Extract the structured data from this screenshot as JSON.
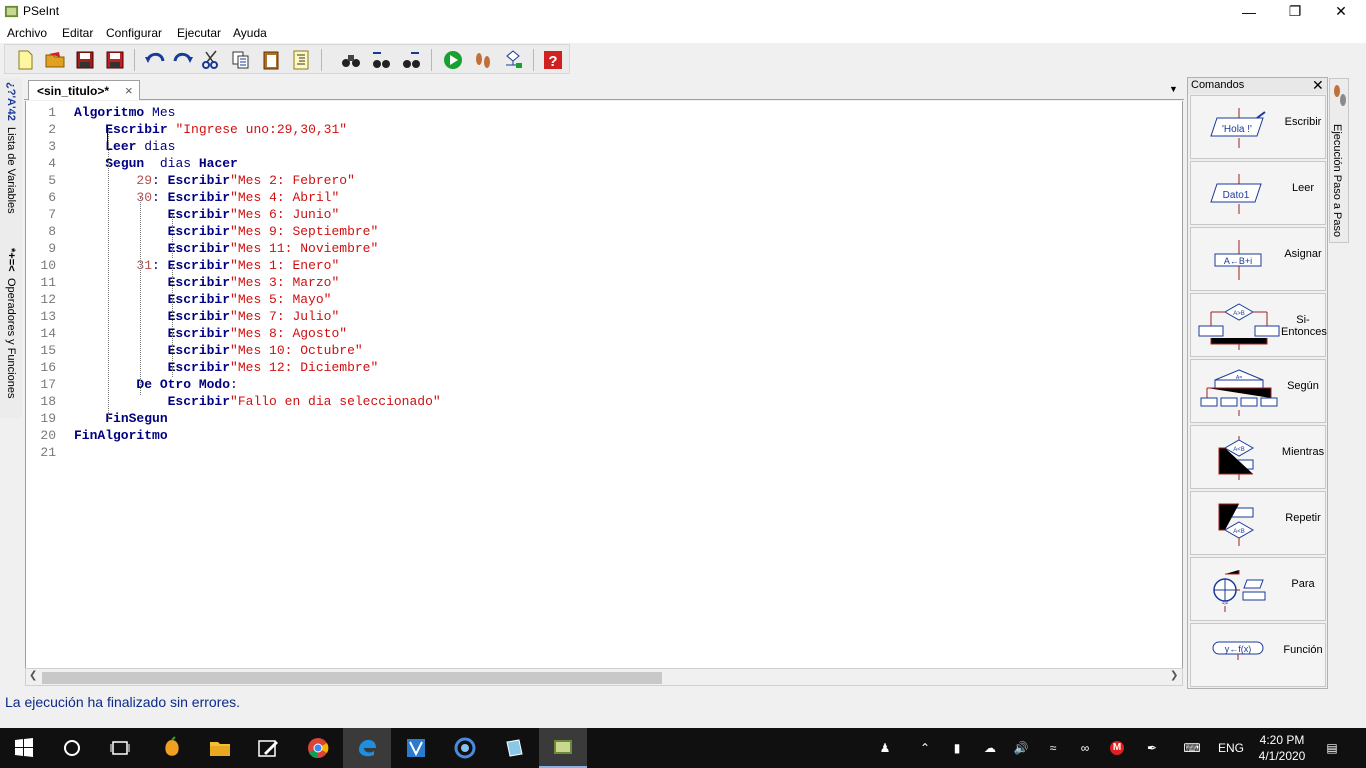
{
  "window": {
    "title": "PSeInt",
    "minimize": "—",
    "maximize": "❐",
    "close": "✕"
  },
  "menu": [
    "Archivo",
    "Editar",
    "Configurar",
    "Ejecutar",
    "Ayuda"
  ],
  "left_tabs": {
    "variables": "Lista de Variables",
    "operators": "Operadores y Funciones",
    "var_glyph": "*+=<",
    "op_glyph": "¿?'A'42"
  },
  "editor": {
    "tab_label": "<sin_titulo>*",
    "tab_close": "×",
    "dropdown": "▼",
    "line_numbers": [
      "1",
      "2",
      "3",
      "4",
      "5",
      "6",
      "7",
      "8",
      "9",
      "10",
      "11",
      "12",
      "13",
      "14",
      "15",
      "16",
      "17",
      "18",
      "19",
      "20",
      "21"
    ],
    "lines": [
      {
        "parts": [
          [
            "kw",
            "Algoritmo"
          ],
          [
            "id",
            " Mes"
          ]
        ]
      },
      {
        "parts": [
          [
            "id",
            "    "
          ],
          [
            "kw",
            "Escribir"
          ],
          [
            "str",
            " \"Ingrese uno:29,30,31\""
          ]
        ]
      },
      {
        "parts": [
          [
            "id",
            "    "
          ],
          [
            "kw",
            "Leer"
          ],
          [
            "id",
            " dias"
          ]
        ]
      },
      {
        "parts": [
          [
            "id",
            "    "
          ],
          [
            "kw",
            "Segun"
          ],
          [
            "id",
            "  dias "
          ],
          [
            "kw",
            "Hacer"
          ]
        ]
      },
      {
        "parts": [
          [
            "id",
            "        "
          ],
          [
            "num",
            "29"
          ],
          [
            "id",
            ": "
          ],
          [
            "kw",
            "Escribir"
          ],
          [
            "str",
            "\"Mes 2: Febrero\""
          ]
        ]
      },
      {
        "parts": [
          [
            "id",
            "        "
          ],
          [
            "num",
            "30"
          ],
          [
            "id",
            ": "
          ],
          [
            "kw",
            "Escribir"
          ],
          [
            "str",
            "\"Mes 4: Abril\""
          ]
        ]
      },
      {
        "parts": [
          [
            "id",
            "            "
          ],
          [
            "kw",
            "Escribir"
          ],
          [
            "str",
            "\"Mes 6: Junio\""
          ]
        ]
      },
      {
        "parts": [
          [
            "id",
            "            "
          ],
          [
            "kw",
            "Escribir"
          ],
          [
            "str",
            "\"Mes 9: Septiembre\""
          ]
        ]
      },
      {
        "parts": [
          [
            "id",
            "            "
          ],
          [
            "kw",
            "Escribir"
          ],
          [
            "str",
            "\"Mes 11: Noviembre\""
          ]
        ]
      },
      {
        "parts": [
          [
            "id",
            "        "
          ],
          [
            "num",
            "31"
          ],
          [
            "id",
            ": "
          ],
          [
            "kw",
            "Escribir"
          ],
          [
            "str",
            "\"Mes 1: Enero\""
          ]
        ]
      },
      {
        "parts": [
          [
            "id",
            "            "
          ],
          [
            "kw",
            "Escribir"
          ],
          [
            "str",
            "\"Mes 3: Marzo\""
          ]
        ]
      },
      {
        "parts": [
          [
            "id",
            "            "
          ],
          [
            "kw",
            "Escribir"
          ],
          [
            "str",
            "\"Mes 5: Mayo\""
          ]
        ]
      },
      {
        "parts": [
          [
            "id",
            "            "
          ],
          [
            "kw",
            "Escribir"
          ],
          [
            "str",
            "\"Mes 7: Julio\""
          ]
        ]
      },
      {
        "parts": [
          [
            "id",
            "            "
          ],
          [
            "kw",
            "Escribir"
          ],
          [
            "str",
            "\"Mes 8: Agosto\""
          ]
        ]
      },
      {
        "parts": [
          [
            "id",
            "            "
          ],
          [
            "kw",
            "Escribir"
          ],
          [
            "str",
            "\"Mes 10: Octubre\""
          ]
        ]
      },
      {
        "parts": [
          [
            "id",
            "            "
          ],
          [
            "kw",
            "Escribir"
          ],
          [
            "str",
            "\"Mes 12: Diciembre\""
          ]
        ]
      },
      {
        "parts": [
          [
            "id",
            "        "
          ],
          [
            "kw",
            "De Otro Modo"
          ],
          [
            "id",
            ":"
          ]
        ]
      },
      {
        "parts": [
          [
            "id",
            "            "
          ],
          [
            "kw",
            "Escribir"
          ],
          [
            "str",
            "\"Fallo en dia seleccionado\""
          ]
        ]
      },
      {
        "parts": [
          [
            "id",
            "    "
          ],
          [
            "kw",
            "FinSegun"
          ]
        ]
      },
      {
        "parts": [
          [
            "kw",
            "FinAlgoritmo"
          ]
        ]
      },
      {
        "parts": []
      }
    ]
  },
  "commands": {
    "title": "Comandos",
    "close": "✕",
    "items": [
      {
        "label": "Escribir",
        "icon": "'Hola !'"
      },
      {
        "label": "Leer",
        "icon": "Dato1"
      },
      {
        "label": "Asignar",
        "icon": "A←B+i"
      },
      {
        "label": "Si-Entonces",
        "icon": "A>B"
      },
      {
        "label": "Según",
        "icon": "A="
      },
      {
        "label": "Mientras",
        "icon": "A<B"
      },
      {
        "label": "Repetir",
        "icon": "A<B"
      },
      {
        "label": "Para",
        "icon": "1|2"
      },
      {
        "label": "Función",
        "icon": "y←f(x)"
      }
    ]
  },
  "right_tab": "Ejecución Paso a Paso",
  "status": "La ejecución ha finalizado sin errores.",
  "taskbar": {
    "lang": "ENG",
    "time": "4:20 PM",
    "date": "4/1/2020"
  },
  "colors": {
    "keyword": "#000080",
    "string": "#d01010",
    "number": "#b05050",
    "status": "#0b2a8a"
  }
}
